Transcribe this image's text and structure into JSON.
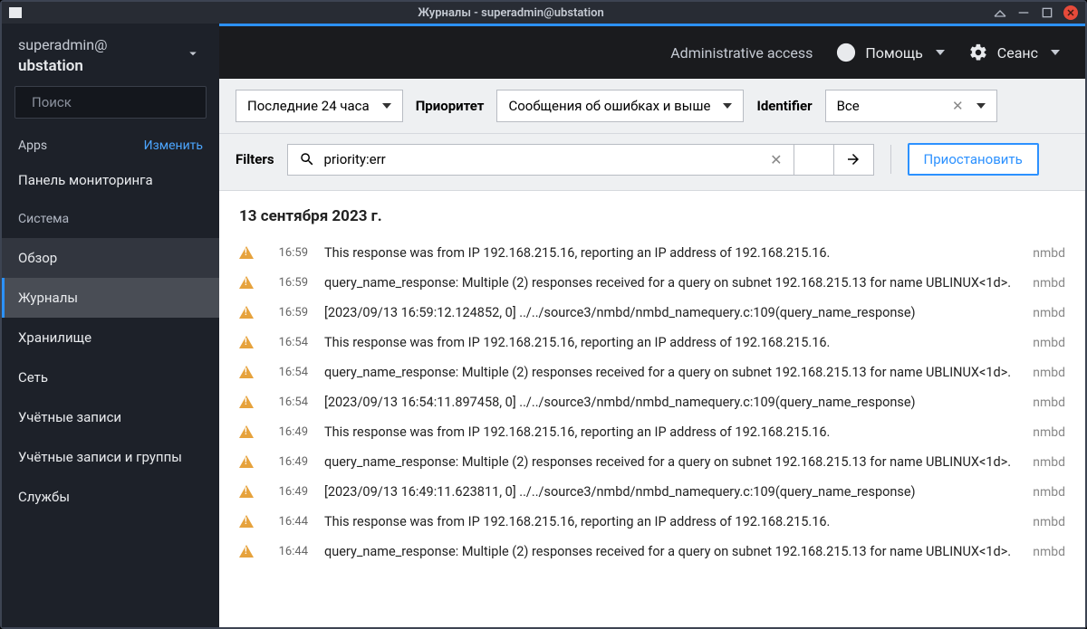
{
  "window": {
    "title": "Журналы - superadmin@ubstation"
  },
  "sidebar": {
    "user": "superadmin@",
    "host": "ubstation",
    "search_placeholder": "Поиск",
    "apps_label": "Apps",
    "edit_label": "Изменить",
    "items": [
      {
        "label": "Панель мониторинга",
        "active": false
      },
      {
        "label": "Система",
        "active": false,
        "dim": true
      },
      {
        "label": "Обзор",
        "active": false,
        "highlight": true
      },
      {
        "label": "Журналы",
        "active": true
      },
      {
        "label": "Хранилище",
        "active": false
      },
      {
        "label": "Сеть",
        "active": false
      },
      {
        "label": "Учётные записи",
        "active": false
      },
      {
        "label": "Учётные записи и группы",
        "active": false
      },
      {
        "label": "Службы",
        "active": false
      }
    ]
  },
  "topbar": {
    "admin_access": "Administrative access",
    "help": "Помощь",
    "session": "Сеанс"
  },
  "filters": {
    "time_range": "Последние 24 часа",
    "priority_label": "Приоритет",
    "priority_value": "Сообщения об ошибках и выше",
    "identifier_label": "Identifier",
    "identifier_value": "Все",
    "filters_label": "Filters",
    "search_value": "priority:err",
    "pause_label": "Приостановить"
  },
  "logs": {
    "date": "13 сентября 2023 г.",
    "rows": [
      {
        "time": "16:59",
        "msg": "This response was from IP 192.168.215.16, reporting an IP address of 192.168.215.16.",
        "svc": "nmbd"
      },
      {
        "time": "16:59",
        "msg": "query_name_response: Multiple (2) responses received for a query on subnet 192.168.215.13 for name UBLINUX<1d>.",
        "svc": "nmbd"
      },
      {
        "time": "16:59",
        "msg": "[2023/09/13 16:59:12.124852, 0] ../../source3/nmbd/nmbd_namequery.c:109(query_name_response)",
        "svc": "nmbd"
      },
      {
        "time": "16:54",
        "msg": "This response was from IP 192.168.215.16, reporting an IP address of 192.168.215.16.",
        "svc": "nmbd"
      },
      {
        "time": "16:54",
        "msg": "query_name_response: Multiple (2) responses received for a query on subnet 192.168.215.13 for name UBLINUX<1d>.",
        "svc": "nmbd"
      },
      {
        "time": "16:54",
        "msg": "[2023/09/13 16:54:11.897458, 0] ../../source3/nmbd/nmbd_namequery.c:109(query_name_response)",
        "svc": "nmbd"
      },
      {
        "time": "16:49",
        "msg": "This response was from IP 192.168.215.16, reporting an IP address of 192.168.215.16.",
        "svc": "nmbd"
      },
      {
        "time": "16:49",
        "msg": "query_name_response: Multiple (2) responses received for a query on subnet 192.168.215.13 for name UBLINUX<1d>.",
        "svc": "nmbd"
      },
      {
        "time": "16:49",
        "msg": "[2023/09/13 16:49:11.623811, 0] ../../source3/nmbd/nmbd_namequery.c:109(query_name_response)",
        "svc": "nmbd"
      },
      {
        "time": "16:44",
        "msg": "This response was from IP 192.168.215.16, reporting an IP address of 192.168.215.16.",
        "svc": "nmbd"
      },
      {
        "time": "16:44",
        "msg": "query_name_response: Multiple (2) responses received for a query on subnet 192.168.215.13 for name UBLINUX<1d>.",
        "svc": "nmbd"
      }
    ]
  }
}
